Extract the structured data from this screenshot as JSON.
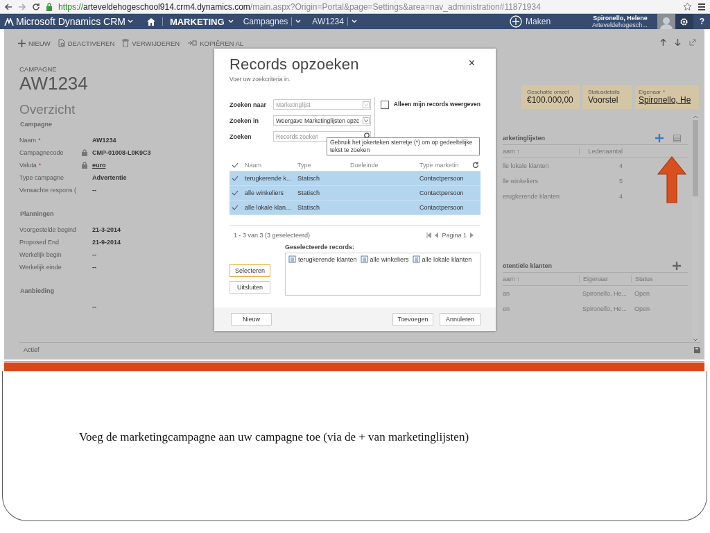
{
  "browser": {
    "url_scheme": "https://",
    "url_host": "arteveldehogeschool914.crm4.dynamics.com",
    "url_path": "/main.aspx?Origin=Portal&page=Settings&area=nav_administration#11871934"
  },
  "nav": {
    "app": "Microsoft Dynamics CRM",
    "area": "MARKETING",
    "entity": "Campagnes",
    "record": "AW1234",
    "create": "Maken",
    "user_name": "Spironello, Helene",
    "user_org": "Arteveldehogesch...",
    "help": "?"
  },
  "commands": [
    {
      "kind": "new",
      "label": "NIEUW"
    },
    {
      "kind": "deactivate",
      "label": "DEACTIVEREN"
    },
    {
      "kind": "delete",
      "label": "VERWIJDEREN"
    },
    {
      "kind": "copy",
      "label": "KOPIËREN AL"
    }
  ],
  "record": {
    "entity": "CAMPAGNE",
    "title": "AW1234"
  },
  "header_fields": [
    {
      "label": "Geschatte omzet",
      "value": "€100.000,00",
      "link": false
    },
    {
      "label": "Statusdetails",
      "value": "Voorstel",
      "link": false
    },
    {
      "label": "Eigenaar",
      "required_mark": "*",
      "value": "Spironello, He",
      "link": true
    }
  ],
  "overview": {
    "title": "Overzicht",
    "sections": [
      {
        "title": "Campagne",
        "fields": [
          {
            "label": "Naam",
            "required_mark": "*",
            "value": "AW1234",
            "locked": false,
            "link": false
          },
          {
            "label": "Campagnecode",
            "value": "CMP-01008-L0K9C3",
            "locked": true,
            "link": false
          },
          {
            "label": "Valuta",
            "required_mark": "*",
            "value": "euro",
            "locked": true,
            "link": true
          },
          {
            "label": "Type campagne",
            "value": "Advertentie",
            "locked": false,
            "link": false
          },
          {
            "label": "Verwachte respons (",
            "value": "--",
            "locked": false,
            "link": false
          }
        ]
      },
      {
        "title": "Planningen",
        "fields": [
          {
            "label": "Voorgestelde begind",
            "value": "21-3-2014",
            "locked": false,
            "link": false
          },
          {
            "label": "Proposed End",
            "value": "21-9-2014",
            "locked": false,
            "link": false
          },
          {
            "label": "Werkelijk begin",
            "value": "--",
            "locked": false,
            "link": false
          },
          {
            "label": "Werkelijk einde",
            "value": "--",
            "locked": false,
            "link": false
          }
        ]
      },
      {
        "title": "Aanbieding",
        "fields": [
          {
            "value": "--",
            "locked": false,
            "link": false
          }
        ]
      }
    ]
  },
  "subgrids": [
    {
      "title": "arketinglijsten",
      "add_highlighted": true,
      "view_button": true,
      "columns": [
        "aam ↑",
        "Ledenaantal"
      ],
      "rows": [
        [
          "lle lokale klanten",
          "4"
        ],
        [
          "lle winkeliers",
          "5"
        ],
        [
          "erugkerende klanten",
          "4"
        ]
      ]
    },
    {
      "title": "otentiële klanten",
      "add_highlighted": false,
      "view_button": false,
      "columns": [
        "aam ↑",
        "Eigenaar",
        "Status"
      ],
      "rows": [
        [
          "an",
          "Spironello, He...",
          "Open"
        ],
        [
          "en",
          "Spironello, He...",
          "Open"
        ]
      ]
    }
  ],
  "status_bar": {
    "status": "Actief"
  },
  "dialog": {
    "title": "Records opzoeken",
    "subtitle": "Voer uw zoekcriteria in.",
    "close": "×",
    "look_for": {
      "label": "Zoeken naar",
      "value": "Marketinglijst",
      "disabled": true
    },
    "look_in": {
      "label": "Zoeken in",
      "value": "Weergave Marketinglijsten opzc",
      "disabled": false
    },
    "search": {
      "label": "Zoeken",
      "placeholder": "Records zoeken"
    },
    "only_mine": {
      "label": "Alleen mijn records weergeven",
      "checked": false
    },
    "tooltip": "Gebruik het jokerteken sterretje (*) om op gedeeltelijke tekst te zoeken",
    "columns": [
      "Naam",
      "Type",
      "Doeleinde",
      "Type marketin"
    ],
    "rows": [
      {
        "name": "terugkerende k...",
        "type": "Statisch",
        "marketing_type": "Contactpersoon",
        "selected": true
      },
      {
        "name": "alle winkeliers",
        "type": "Statisch",
        "marketing_type": "Contactpersoon",
        "selected": true
      },
      {
        "name": "alle lokale klan...",
        "type": "Statisch",
        "marketing_type": "Contactpersoon",
        "selected": true
      }
    ],
    "paging_summary": "1 - 3  van 3 (3 geselecteerd)",
    "page": "Pagina 1",
    "selected_label": "Geselecteerde records:",
    "selected_records": [
      "terugkerende klanten",
      "alle winkeliers",
      "alle lokale klanten"
    ],
    "side_buttons": [
      {
        "label": "Selecteren",
        "focused": true
      },
      {
        "label": "Uitsluiten",
        "focused": false
      }
    ],
    "footer_buttons": [
      "Nieuw",
      "Toevoegen",
      "Annuleren"
    ]
  },
  "caption": "Voeg de marketingcampagne aan uw campagne toe (via de + van marketinglijsten)"
}
